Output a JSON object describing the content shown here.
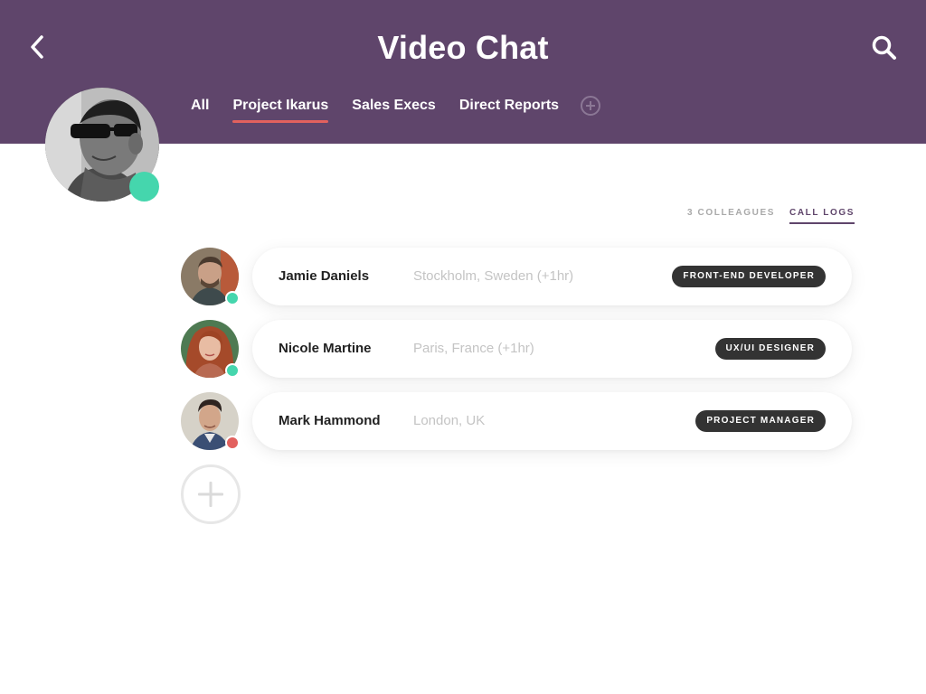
{
  "header": {
    "title": "Video Chat",
    "back_icon": "chevron-left-icon",
    "search_icon": "search-icon",
    "background": "#5f456b"
  },
  "tabs": [
    {
      "label": "All",
      "active": false
    },
    {
      "label": "Project Ikarus",
      "active": true
    },
    {
      "label": "Sales Execs",
      "active": false
    },
    {
      "label": "Direct Reports",
      "active": false
    }
  ],
  "tab_add_icon": "plus-circle-icon",
  "profile": {
    "status": "online",
    "status_color": "#45d6ad"
  },
  "subnav": {
    "colleagues": "3 COLLEAGUES",
    "call_logs": "CALL LOGS"
  },
  "contacts": [
    {
      "name": "Jamie Daniels",
      "location": "Stockholm, Sweden (+1hr)",
      "role": "FRONT-END DEVELOPER",
      "status": "online",
      "status_color": "#45d6ad"
    },
    {
      "name": "Nicole Martine",
      "location": "Paris, France (+1hr)",
      "role": "UX/UI DESIGNER",
      "status": "online",
      "status_color": "#45d6ad"
    },
    {
      "name": "Mark Hammond",
      "location": "London, UK",
      "role": "PROJECT MANAGER",
      "status": "busy",
      "status_color": "#e2615e"
    }
  ],
  "add_contact_icon": "plus-icon",
  "colors": {
    "accent": "#e2615e",
    "online": "#45d6ad",
    "busy": "#e2615e",
    "badge": "#333333"
  }
}
